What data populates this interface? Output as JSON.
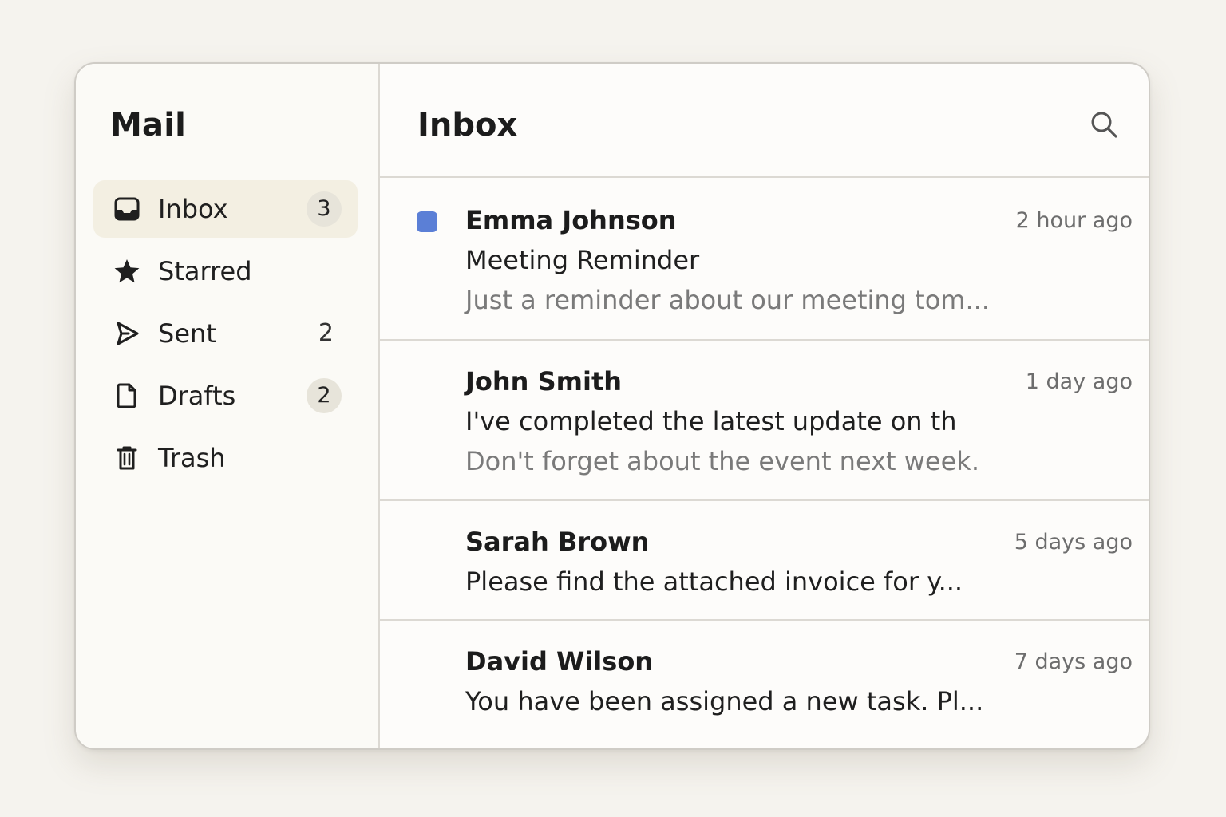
{
  "sidebar": {
    "title": "Mail",
    "items": [
      {
        "label": "Inbox",
        "icon": "inbox-icon",
        "badge": "3",
        "active": true
      },
      {
        "label": "Starred",
        "icon": "star-icon",
        "badge": "",
        "active": false
      },
      {
        "label": "Sent",
        "icon": "send-icon",
        "count": "2",
        "active": false
      },
      {
        "label": "Drafts",
        "icon": "draft-icon",
        "badge": "2",
        "active": false
      },
      {
        "label": "Trash",
        "icon": "trash-icon",
        "badge": "",
        "active": false
      }
    ]
  },
  "main": {
    "title": "Inbox",
    "search_icon": "search-icon",
    "emails": [
      {
        "sender": "Emma Johnson",
        "time": "2 hour ago",
        "subject": "Meeting Reminder",
        "preview": "Just a reminder about our meeting tom...",
        "unread": true
      },
      {
        "sender": "John Smith",
        "time": "1 day ago",
        "subject": "I've completed the latest update on th",
        "preview": "Don't forget about the event next week.",
        "unread": false
      },
      {
        "sender": "Sarah Brown",
        "time": "5 days ago",
        "subject": "Please find  the attached invoice for y...",
        "unread": false
      },
      {
        "sender": "David Wilson",
        "time": "7 days ago",
        "subject": "You have been assigned a new task. Pl...",
        "unread": false
      }
    ]
  },
  "colors": {
    "background": "#f5f3ee",
    "window": "#fdfcfa",
    "active_item": "#f3efe2",
    "unread_indicator": "#5b7fd6",
    "badge": "#e7e4da"
  }
}
